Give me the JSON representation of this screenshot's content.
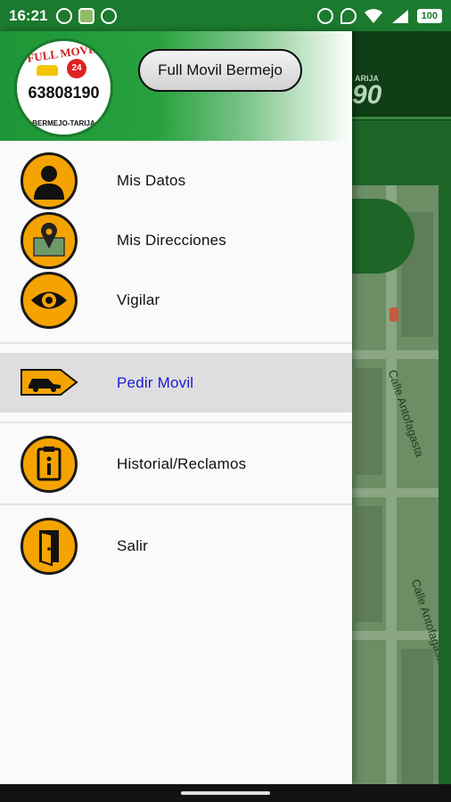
{
  "status_bar": {
    "time": "16:21",
    "battery": "100"
  },
  "background": {
    "header_number": "90",
    "header_sub": "ARIJA",
    "street_1": "Calle Antofagasta",
    "street_2": "Calle Antofagasta"
  },
  "drawer": {
    "logo": {
      "arc_top": "FULL MOVIL",
      "phone": "63808190",
      "arc_bottom": "BERMEJO-TARIJA",
      "badge": "24"
    },
    "header_button": "Full Movil Bermejo",
    "menu": [
      {
        "label": "Mis Datos",
        "icon": "person-icon"
      },
      {
        "label": "Mis Direcciones",
        "icon": "map-pin-icon"
      },
      {
        "label": "Vigilar",
        "icon": "eye-icon"
      },
      {
        "label": "Pedir Movil",
        "icon": "taxi-arrow-icon",
        "active": true
      },
      {
        "label": "Historial/Reclamos",
        "icon": "clipboard-info-icon"
      },
      {
        "label": "Salir",
        "icon": "door-exit-icon"
      }
    ]
  },
  "colors": {
    "brand_green": "#1e9637",
    "icon_orange": "#f5a300",
    "active_text": "#1a1ad6",
    "active_bg": "#dedede"
  }
}
